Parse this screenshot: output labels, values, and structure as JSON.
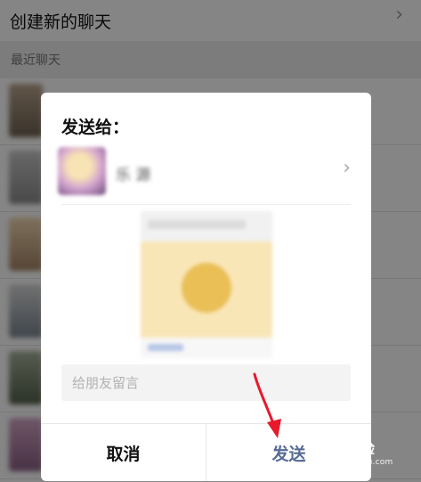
{
  "background": {
    "header_label": "创建新的聊天",
    "header_chevron": "chevron-right-icon",
    "section_label": "最近聊天"
  },
  "dialog": {
    "title": "发送给：",
    "recipient_name": "乐 源",
    "recipient_chevron": "chevron-right-icon",
    "message_placeholder": "给朋友留言",
    "cancel_label": "取消",
    "send_label": "发送"
  },
  "watermark": {
    "main": "Bai   经验",
    "sub": "jingyan.baidu.com"
  },
  "colors": {
    "send_link": "#576b95",
    "annotation_arrow": "#e8192c",
    "overlay": "rgba(0,0,0,0.48)"
  }
}
